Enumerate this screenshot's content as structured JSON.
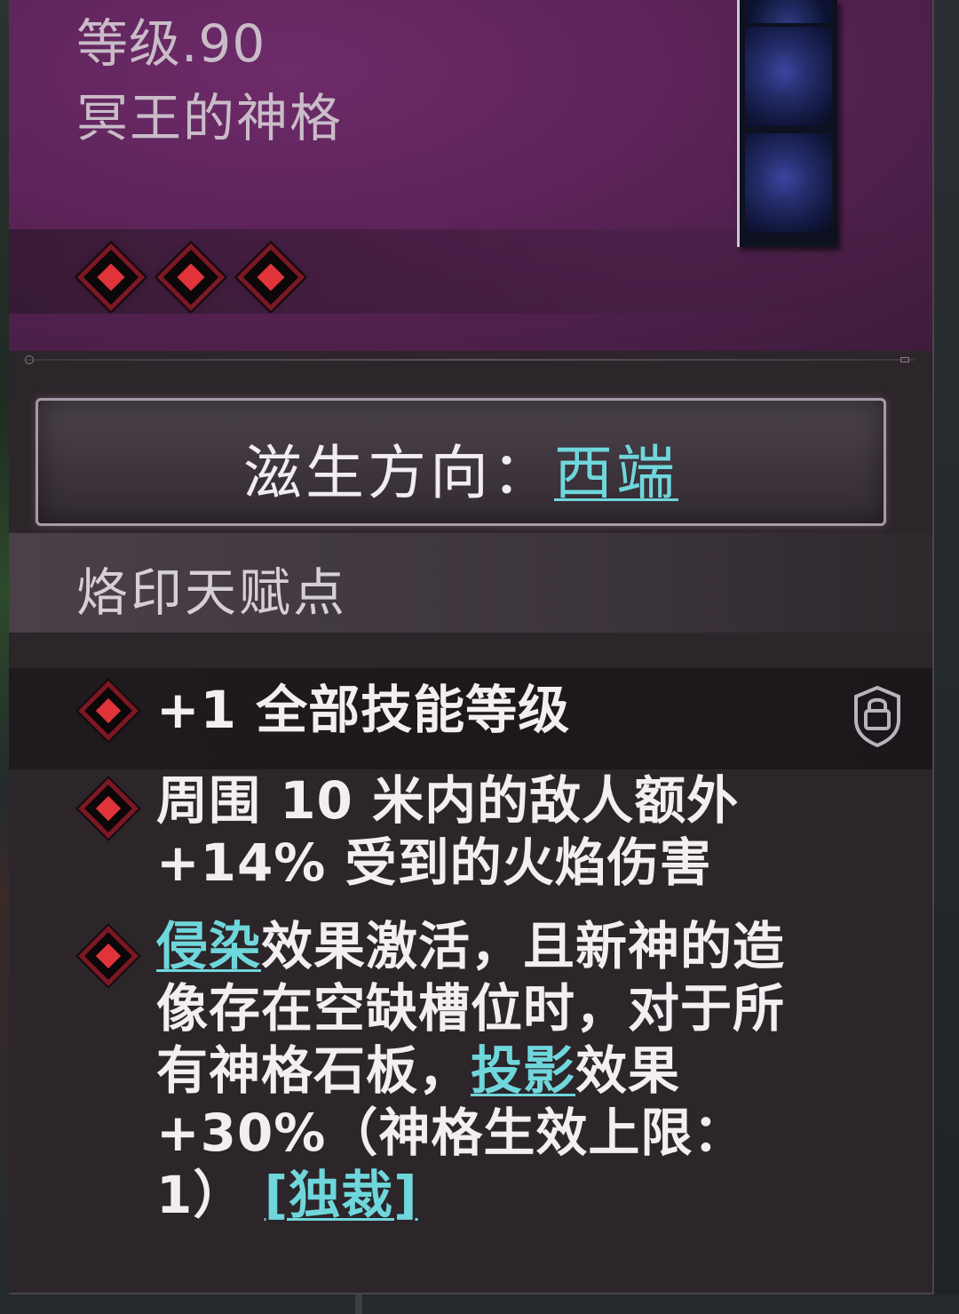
{
  "item": {
    "level_label": "等级.90",
    "name": "冥王的神格"
  },
  "direction": {
    "label": "滋生方向：",
    "value": "西端"
  },
  "talent_section": {
    "title": "烙印天赋点"
  },
  "stats": [
    {
      "segments": [
        {
          "text": "+1 全部技能等级",
          "link": false
        }
      ],
      "locked": true
    },
    {
      "segments": [
        {
          "text": "周围 10 米内的敌人额外 +14% 受到的火焰伤害",
          "link": false
        }
      ],
      "locked": false
    },
    {
      "segments": [
        {
          "text": "侵染",
          "link": true
        },
        {
          "text": "效果激活，且新神的造像存在空缺槽位时，对于所有神格石板，",
          "link": false
        },
        {
          "text": "投影",
          "link": true
        },
        {
          "text": "效果 +30%（神格生效上限：1）",
          "link": false
        },
        {
          "text": "[独裁]",
          "link": true
        }
      ],
      "locked": false
    }
  ],
  "colors": {
    "header_purple": "#5b2357",
    "link_cyan": "#6fd7dc",
    "gem_red": "#e0333a",
    "panel_bg": "#2c2529"
  },
  "icons": {
    "talent_gem": "red-diamond-gem",
    "lock": "lock-shield-icon"
  }
}
